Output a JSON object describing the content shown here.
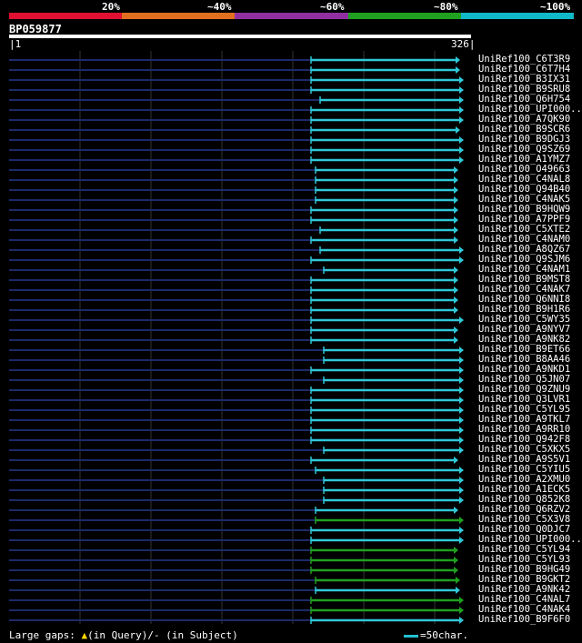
{
  "legend": {
    "labels": [
      "20%",
      "~40%",
      "~60%",
      "~80%",
      "~100%"
    ],
    "colors": [
      "#e01030",
      "#e07020",
      "#9030a0",
      "#20a020",
      "#10b8c8"
    ]
  },
  "query": {
    "id": "BP059877",
    "start": "1",
    "end": "326"
  },
  "hits": [
    {
      "name": "UniRef100_C6T3R9",
      "color": "cyan"
    },
    {
      "name": "UniRef100_C6T7H4",
      "color": "cyan"
    },
    {
      "name": "UniRef100_B3IX31",
      "color": "cyan"
    },
    {
      "name": "UniRef100_B9SRU8",
      "color": "cyan"
    },
    {
      "name": "UniRef100_Q6H754",
      "color": "cyan"
    },
    {
      "name": "UniRef100_UPI000..",
      "color": "cyan"
    },
    {
      "name": "UniRef100_A7QK90",
      "color": "cyan"
    },
    {
      "name": "UniRef100_B9SCR6",
      "color": "cyan"
    },
    {
      "name": "UniRef100_B9DGJ3",
      "color": "cyan"
    },
    {
      "name": "UniRef100_Q9SZ69",
      "color": "cyan"
    },
    {
      "name": "UniRef100_A1YMZ7",
      "color": "cyan"
    },
    {
      "name": "UniRef100_O49663",
      "color": "cyan"
    },
    {
      "name": "UniRef100_C4NAL8",
      "color": "cyan"
    },
    {
      "name": "UniRef100_Q94B40",
      "color": "cyan"
    },
    {
      "name": "UniRef100_C4NAK5",
      "color": "cyan"
    },
    {
      "name": "UniRef100_B9HQW9",
      "color": "cyan"
    },
    {
      "name": "UniRef100_A7PPF9",
      "color": "cyan"
    },
    {
      "name": "UniRef100_C5XTE2",
      "color": "cyan"
    },
    {
      "name": "UniRef100_C4NAM0",
      "color": "cyan"
    },
    {
      "name": "UniRef100_A8QZ67",
      "color": "cyan"
    },
    {
      "name": "UniRef100_Q9SJM6",
      "color": "cyan"
    },
    {
      "name": "UniRef100_C4NAM1",
      "color": "cyan"
    },
    {
      "name": "UniRef100_B9MST8",
      "color": "cyan"
    },
    {
      "name": "UniRef100_C4NAK7",
      "color": "cyan"
    },
    {
      "name": "UniRef100_Q6NNI8",
      "color": "cyan"
    },
    {
      "name": "UniRef100_B9H1R6",
      "color": "cyan"
    },
    {
      "name": "UniRef100_C5WY35",
      "color": "cyan"
    },
    {
      "name": "UniRef100_A9NYV7",
      "color": "cyan"
    },
    {
      "name": "UniRef100_A9NK82",
      "color": "cyan"
    },
    {
      "name": "UniRef100_B9ET66",
      "color": "cyan"
    },
    {
      "name": "UniRef100_B8AA46",
      "color": "cyan"
    },
    {
      "name": "UniRef100_A9NKD1",
      "color": "cyan"
    },
    {
      "name": "UniRef100_Q5JN07",
      "color": "cyan"
    },
    {
      "name": "UniRef100_Q9ZNU9",
      "color": "cyan"
    },
    {
      "name": "UniRef100_Q3LVR1",
      "color": "cyan"
    },
    {
      "name": "UniRef100_C5YL95",
      "color": "cyan"
    },
    {
      "name": "UniRef100_A9TKL7",
      "color": "cyan"
    },
    {
      "name": "UniRef100_A9RR10",
      "color": "cyan"
    },
    {
      "name": "UniRef100_Q942F8",
      "color": "cyan"
    },
    {
      "name": "UniRef100_C5XKX5",
      "color": "cyan"
    },
    {
      "name": "UniRef100_A9S5V1",
      "color": "cyan"
    },
    {
      "name": "UniRef100_C5YIU5",
      "color": "cyan"
    },
    {
      "name": "UniRef100_A2XMU0",
      "color": "cyan"
    },
    {
      "name": "UniRef100_A1ECK5",
      "color": "cyan"
    },
    {
      "name": "UniRef100_Q852K8",
      "color": "cyan"
    },
    {
      "name": "UniRef100_Q6RZV2",
      "color": "cyan"
    },
    {
      "name": "UniRef100_C5X3V8",
      "color": "green"
    },
    {
      "name": "UniRef100_Q0DJC7",
      "color": "cyan"
    },
    {
      "name": "UniRef100_UPI000..",
      "color": "cyan"
    },
    {
      "name": "UniRef100_C5YL94",
      "color": "green"
    },
    {
      "name": "UniRef100_C5YL93",
      "color": "green"
    },
    {
      "name": "UniRef100_B9HG49",
      "color": "green"
    },
    {
      "name": "UniRef100_B9GKT2",
      "color": "green"
    },
    {
      "name": "UniRef100_A9NK42",
      "color": "cyan"
    },
    {
      "name": "UniRef100_C4NAL7",
      "color": "green"
    },
    {
      "name": "UniRef100_C4NAK4",
      "color": "green"
    },
    {
      "name": "UniRef100_B9F6F0",
      "color": "cyan"
    }
  ],
  "footer": {
    "gaps_label": "Large gaps:",
    "query_gap_symbol": "▲",
    "query_gap_text": "(in Query)/",
    "subject_gap_symbol": "-",
    "subject_gap_text": " (in Subject)",
    "scale_text": "=50char."
  }
}
